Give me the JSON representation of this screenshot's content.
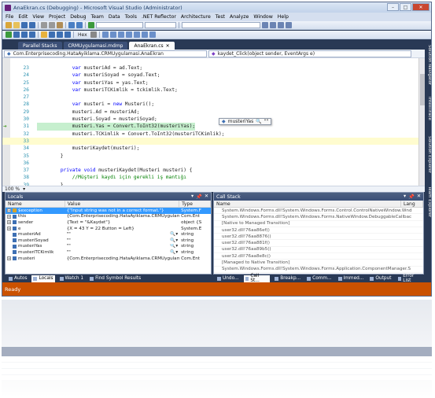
{
  "window": {
    "title": "AnaEkran.cs (Debugging) - Microsoft Visual Studio (Administrator)",
    "buttons": {
      "minimize": "–",
      "maximize": "□",
      "close": "✕"
    }
  },
  "menu": [
    "File",
    "Edit",
    "View",
    "Project",
    "Debug",
    "Team",
    "Data",
    "Tools",
    ".NET Reflector",
    "Architecture",
    "Test",
    "Analyze",
    "Window",
    "Help"
  ],
  "toolbar": {
    "hex_label": "Hex"
  },
  "doc_tabs": [
    {
      "label": "Parallel Stacks"
    },
    {
      "label": "CRMUygulamasi.mdmp"
    },
    {
      "label": "AnaEkran.cs"
    }
  ],
  "nav": {
    "class_combo": "Com.Enterprisecoding.HataAyiklama.CRMUygulamasi.AnaEkran",
    "member_combo": "kaydet_Click(object sender, EventArgs e)"
  },
  "code_lines": [
    {
      "num": "23",
      "code": "            var musteriAd = ad.Text;"
    },
    {
      "num": "24",
      "code": "            var musteriSoyad = soyad.Text;"
    },
    {
      "num": "25",
      "code": "            var musteriYas = yas.Text;"
    },
    {
      "num": "26",
      "code": "            var musteriTCKimlik = tckimlik.Text;"
    },
    {
      "num": "27",
      "code": ""
    },
    {
      "num": "28",
      "code": "            var musteri = new Musteri();"
    },
    {
      "num": "29",
      "code": "            musteri.Ad = musteriAd;"
    },
    {
      "num": "30",
      "code": "            musteri.Soyad = musteriSoyad;"
    },
    {
      "num": "31",
      "code": "            musteri.Yas = Convert.ToInt32(musteriYas);"
    },
    {
      "num": "32",
      "code": "            musteri.TCKimlik = Convert.ToInt32(musteriTCKimlik);"
    },
    {
      "num": "33",
      "code": ""
    },
    {
      "num": "34",
      "code": "            musteriKaydet(musteri);"
    },
    {
      "num": "35",
      "code": "        }"
    },
    {
      "num": "36",
      "code": ""
    },
    {
      "num": "37",
      "code": "        private void musteriKaydet(Musteri musteri) {"
    },
    {
      "num": "38",
      "code": "            //Müşteri kaydı için gerekli iş mantığı"
    },
    {
      "num": "39",
      "code": "        }"
    }
  ],
  "datatip": {
    "label": "musteriYas",
    "value": "\"\""
  },
  "zoom": "100 %",
  "locals": {
    "title": "Locals",
    "columns": [
      "Name",
      "Value",
      "Type"
    ],
    "rows": [
      {
        "name": "$exception",
        "value": "{\"Input string was not in a correct format.\"}",
        "type": "System.F"
      },
      {
        "name": "this",
        "value": "{Com.Enterprisecoding.HataAyiklama.CRMUygulam",
        "type": "Com.Ent"
      },
      {
        "name": "sender",
        "value": "{Text = \"&Kaydet\"}",
        "type": "object {S"
      },
      {
        "name": "e",
        "value": "{X = 43 Y = 22 Button = Left}",
        "type": "System.E"
      },
      {
        "name": "musteriAd",
        "value": "\"\"",
        "type": "string"
      },
      {
        "name": "musteriSoyad",
        "value": "\"\"",
        "type": "string"
      },
      {
        "name": "musteriYas",
        "value": "\"\"",
        "type": "string"
      },
      {
        "name": "musteriTCKimlik",
        "value": "\"\"",
        "type": "string"
      },
      {
        "name": "musteri",
        "value": "{Com.Enterprisecoding.HataAyiklama.CRMUygulam",
        "type": "Com.Ent"
      }
    ]
  },
  "callstack": {
    "title": "Call Stack",
    "columns": [
      "Name",
      "Lang"
    ],
    "rows": [
      "System.Windows.Forms.dll!System.Windows.Forms.Control.ControlNativeWindow.Wnd",
      "System.Windows.Forms.dll!System.Windows.Forms.NativeWindow.DebuggableCallbac",
      "[Native to Managed Transition]",
      "user32.dll!76aa86ef()",
      "user32.dll!76aa8876()",
      "user32.dll!76aa881f()",
      "user32.dll!76aa89b5()",
      "user32.dll!76aa8e8c()",
      "[Managed to Native Transition]",
      "System.Windows.Forms.dll!System.Windows.Forms.Application.ComponentManager.S"
    ]
  },
  "bottom_tabs_left": [
    "Autos",
    "Locals",
    "Watch 1",
    "Find Symbol Results"
  ],
  "bottom_tabs_right": [
    "Undo...",
    "Call St...",
    "Breakp...",
    "Comm...",
    "Immed...",
    "Output",
    "Error List"
  ],
  "right_dock": [
    "Solution Navigator",
    "IntelliTrace",
    "Solution Explorer",
    "Team Explorer"
  ],
  "status": "Ready",
  "colors": {
    "frame": "#293955",
    "status": "#ca5100",
    "selection": "#3399ff"
  }
}
